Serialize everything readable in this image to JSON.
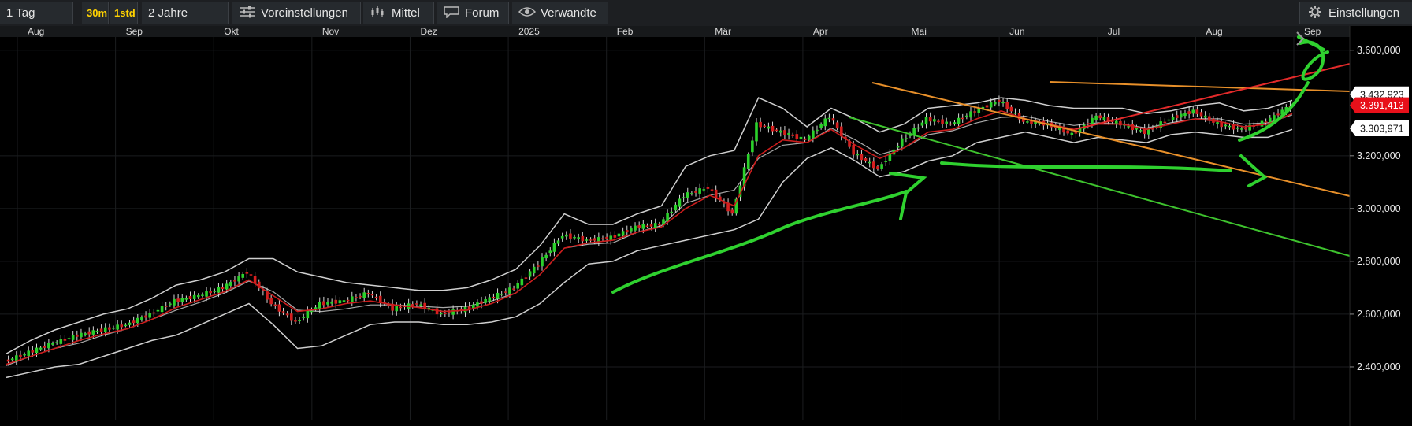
{
  "toolbar": {
    "period": "1 Tag",
    "interval_30m": "30m",
    "interval_1std": "1std",
    "range": "2 Jahre",
    "presets": "Voreinstellungen",
    "average": "Mittel",
    "forum": "Forum",
    "related": "Verwandte",
    "settings": "Einstellungen",
    "icons": {
      "presets": "sliders-icon",
      "average": "candles-icon",
      "forum": "chat-bubble-icon",
      "related": "eye-icon",
      "settings": "gear-icon"
    }
  },
  "chart_data": {
    "type": "line",
    "subtype": "candlestick with bollinger bands",
    "x_labels": [
      "Aug",
      "Sep",
      "Okt",
      "Nov",
      "Dez",
      "2025",
      "Feb",
      "Mär",
      "Apr",
      "Mai",
      "Jun",
      "Jul",
      "Aug",
      "Sep"
    ],
    "y_ticks": [
      "3.600,000",
      "3.200,000",
      "3.000,000",
      "2.800,000",
      "2.600,000",
      "2.400,000"
    ],
    "ylim": [
      2200,
      3650
    ],
    "grid": true,
    "price_flags": [
      {
        "label": "3.432,923",
        "value": 3432.923,
        "color": "#ffffff"
      },
      {
        "label": "3.391,413",
        "value": 3391.413,
        "color": "#e8101a"
      },
      {
        "label": "3.303,971",
        "value": 3303.971,
        "color": "#ffffff"
      }
    ],
    "series": [
      {
        "role": "close",
        "color": "#2bd12b",
        "values": [
          2420,
          2455,
          2490,
          2520,
          2540,
          2560,
          2600,
          2650,
          2670,
          2700,
          2760,
          2640,
          2570,
          2640,
          2650,
          2680,
          2620,
          2640,
          2600,
          2620,
          2660,
          2700,
          2790,
          2900,
          2880,
          2890,
          2930,
          2940,
          3050,
          3080,
          2980,
          3320,
          3290,
          3260,
          3350,
          3210,
          3150,
          3260,
          3340,
          3320,
          3370,
          3410,
          3330,
          3320,
          3280,
          3350,
          3320,
          3290,
          3340,
          3370,
          3320,
          3300,
          3330,
          3391
        ]
      },
      {
        "role": "moving-average",
        "color": "#cc1c1c",
        "values": [
          2410,
          2440,
          2470,
          2500,
          2525,
          2545,
          2580,
          2625,
          2655,
          2685,
          2730,
          2670,
          2610,
          2620,
          2640,
          2650,
          2635,
          2625,
          2610,
          2615,
          2640,
          2680,
          2750,
          2850,
          2870,
          2880,
          2910,
          2930,
          3000,
          3050,
          3010,
          3200,
          3260,
          3250,
          3300,
          3240,
          3190,
          3230,
          3290,
          3300,
          3340,
          3370,
          3340,
          3320,
          3300,
          3320,
          3320,
          3300,
          3320,
          3340,
          3330,
          3310,
          3320,
          3360
        ]
      },
      {
        "role": "bollinger-upper",
        "color": "#cfcfcf",
        "values": [
          2450,
          2500,
          2540,
          2570,
          2600,
          2620,
          2660,
          2710,
          2730,
          2760,
          2810,
          2810,
          2760,
          2740,
          2720,
          2710,
          2700,
          2690,
          2690,
          2700,
          2730,
          2770,
          2860,
          2980,
          2940,
          2940,
          2980,
          3010,
          3160,
          3200,
          3220,
          3420,
          3380,
          3310,
          3380,
          3340,
          3290,
          3320,
          3380,
          3390,
          3400,
          3420,
          3410,
          3390,
          3380,
          3380,
          3380,
          3360,
          3370,
          3390,
          3400,
          3370,
          3380,
          3410
        ]
      },
      {
        "role": "bollinger-lower",
        "color": "#cfcfcf",
        "values": [
          2360,
          2380,
          2400,
          2410,
          2440,
          2470,
          2500,
          2520,
          2560,
          2600,
          2640,
          2560,
          2470,
          2480,
          2520,
          2560,
          2570,
          2570,
          2560,
          2560,
          2570,
          2590,
          2640,
          2720,
          2790,
          2800,
          2840,
          2860,
          2880,
          2900,
          2920,
          2960,
          3100,
          3190,
          3230,
          3180,
          3120,
          3140,
          3180,
          3200,
          3250,
          3270,
          3290,
          3270,
          3250,
          3270,
          3260,
          3250,
          3280,
          3290,
          3280,
          3270,
          3270,
          3300
        ]
      }
    ],
    "drawn_lines": [
      {
        "color": "#e8902a",
        "label": "downtrend resistance"
      },
      {
        "color": "#e8902a",
        "label": "horizontal resistance"
      },
      {
        "color": "#e32a2a",
        "label": "rising trendline"
      },
      {
        "color": "#3ec32e",
        "label": "lower channel"
      },
      {
        "color": "#2fd12f",
        "label": "freehand annotations"
      }
    ]
  }
}
